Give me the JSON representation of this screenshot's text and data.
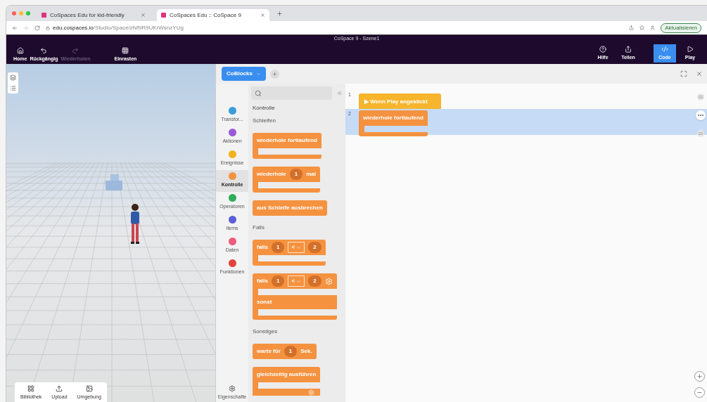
{
  "browser": {
    "tabs": [
      {
        "title": "CoSpaces Edu for kid-friendly",
        "selected": false
      },
      {
        "title": "CoSpaces Edu :: CoSpace 9",
        "selected": true
      }
    ],
    "url": {
      "domain": "edu.cospaces.io",
      "path": "/Studio/Space/zNf9R9UKrWsnzYUg"
    },
    "update_button": "Aktualisieren"
  },
  "toolbar": {
    "title": "CoSpace 9 - Szene1",
    "left_tools": [
      {
        "kind": "home",
        "label": "Home",
        "disabled": false
      },
      {
        "kind": "undo",
        "label": "Rückgängig",
        "disabled": false
      },
      {
        "kind": "redo",
        "label": "Wiederholen",
        "disabled": true
      },
      {
        "kind": "grid",
        "label": "Einrasten",
        "disabled": false
      }
    ],
    "right_tools": [
      {
        "kind": "help",
        "label": "Hilfe",
        "selected": false
      },
      {
        "kind": "share",
        "label": "Teilen",
        "selected": false
      },
      {
        "kind": "code",
        "label": "Code",
        "selected": true
      },
      {
        "kind": "play",
        "label": "Play",
        "selected": false
      }
    ]
  },
  "viewport": {
    "bottom_tools": [
      {
        "kind": "library",
        "label": "Bibliothek"
      },
      {
        "kind": "upload",
        "label": "Upload"
      },
      {
        "kind": "environment",
        "label": "Umgebung"
      }
    ]
  },
  "code_panel": {
    "editor_button": "CoBlocks",
    "categories": [
      {
        "label": "Transfor...",
        "color": "#3b9ddb",
        "selected": false
      },
      {
        "label": "Aktionen",
        "color": "#9b59d6",
        "selected": false
      },
      {
        "label": "Ereignisse",
        "color": "#f2b21e",
        "selected": false
      },
      {
        "label": "Kontrolle",
        "color": "#f59240",
        "selected": true
      },
      {
        "label": "Operatoren",
        "color": "#2fae5a",
        "selected": false
      },
      {
        "label": "Items",
        "color": "#5b5fd9",
        "selected": false
      },
      {
        "label": "Daten",
        "color": "#ec5b7d",
        "selected": false
      },
      {
        "label": "Funktionen",
        "color": "#e1443c",
        "selected": false
      }
    ],
    "properties_label": "Eigenschafte",
    "palette": {
      "title": "Kontrolle",
      "sections": [
        {
          "heading": "Schleifen",
          "blocks": [
            {
              "kind": "loop",
              "parts": [
                {
                  "kind": "label",
                  "text": "wiederhole fortlaufend"
                }
              ]
            },
            {
              "kind": "loop",
              "parts": [
                {
                  "kind": "label",
                  "text": "wiederhole"
                },
                {
                  "kind": "number",
                  "text": "1"
                },
                {
                  "kind": "label",
                  "text": "mal"
                }
              ]
            },
            {
              "kind": "plain",
              "parts": [
                {
                  "kind": "label",
                  "text": "aus Schleife ausbrechen"
                }
              ]
            }
          ]
        },
        {
          "heading": "Falls",
          "blocks": [
            {
              "kind": "loop",
              "parts": [
                {
                  "kind": "label",
                  "text": "falls"
                },
                {
                  "kind": "number",
                  "text": "1"
                },
                {
                  "kind": "dropdown",
                  "text": "<"
                },
                {
                  "kind": "number",
                  "text": "2"
                }
              ]
            },
            {
              "kind": "ifelse",
              "else_label": "sonst",
              "parts": [
                {
                  "kind": "label",
                  "text": "falls"
                },
                {
                  "kind": "number",
                  "text": "1"
                },
                {
                  "kind": "dropdown",
                  "text": "<"
                },
                {
                  "kind": "number",
                  "text": "2"
                },
                {
                  "kind": "gear"
                }
              ]
            }
          ]
        },
        {
          "heading": "Sonstiges",
          "blocks": [
            {
              "kind": "plain",
              "parts": [
                {
                  "kind": "label",
                  "text": "warte für"
                },
                {
                  "kind": "number",
                  "text": "1"
                },
                {
                  "kind": "label",
                  "text": "Sek."
                }
              ]
            },
            {
              "kind": "parallel",
              "parts": [
                {
                  "kind": "label",
                  "text": "gleichzeitig ausführen"
                }
              ]
            }
          ]
        }
      ]
    },
    "lines": [
      {
        "number": "1",
        "selected": false,
        "block": {
          "kind": "hat",
          "text": "▶ Wenn Play angeklickt"
        }
      },
      {
        "number": "2",
        "selected": true,
        "block": {
          "kind": "loop",
          "text": "wiederhole fortlaufend"
        }
      }
    ]
  }
}
